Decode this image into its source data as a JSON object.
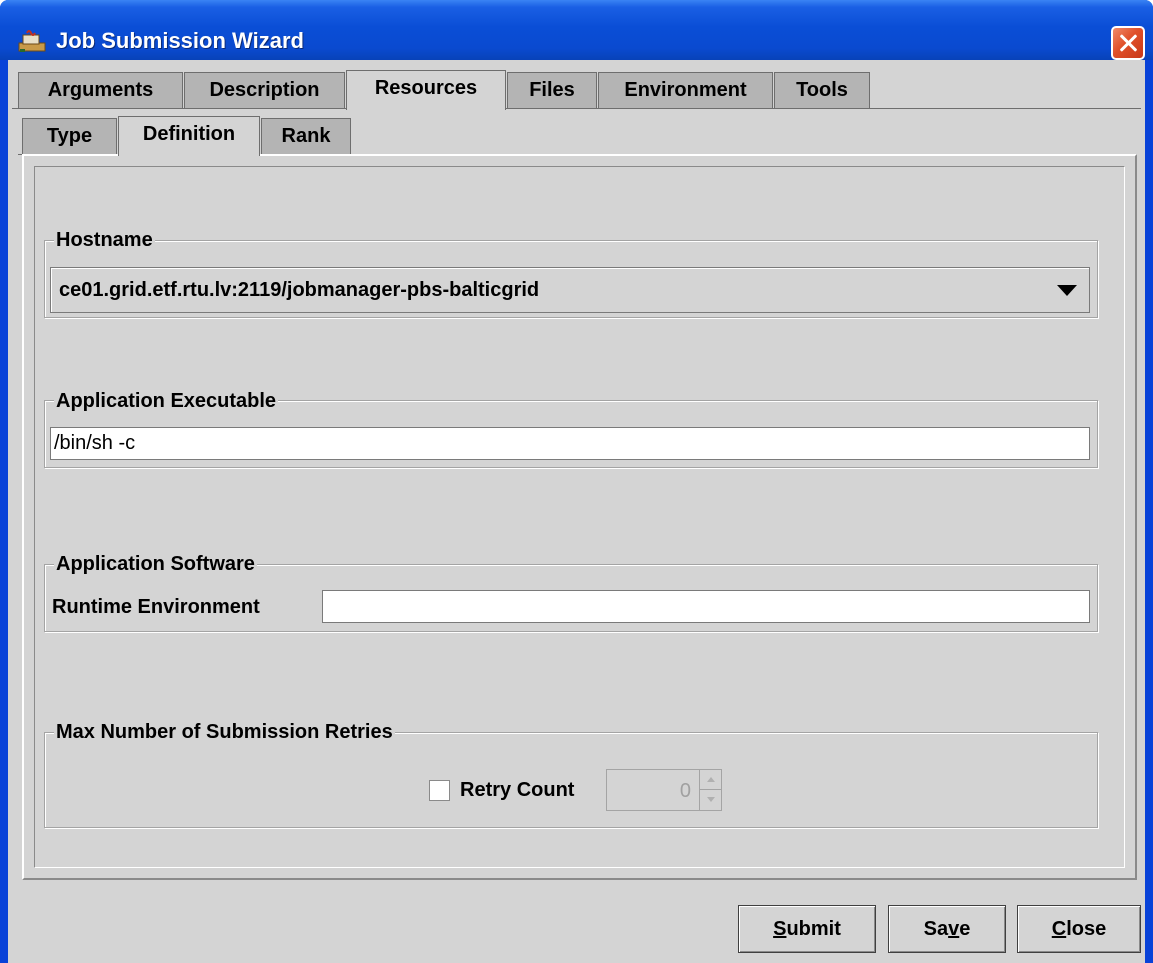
{
  "window": {
    "title": "Job Submission Wizard"
  },
  "main_tabs": [
    {
      "label": "Arguments",
      "selected": false
    },
    {
      "label": "Description",
      "selected": false
    },
    {
      "label": "Resources",
      "selected": true
    },
    {
      "label": "Files",
      "selected": false
    },
    {
      "label": "Environment",
      "selected": false
    },
    {
      "label": "Tools",
      "selected": false
    }
  ],
  "sub_tabs": [
    {
      "label": "Type",
      "selected": false
    },
    {
      "label": "Definition",
      "selected": true
    },
    {
      "label": "Rank",
      "selected": false
    }
  ],
  "hostname": {
    "title": "Hostname",
    "value": "ce01.grid.etf.rtu.lv:2119/jobmanager-pbs-balticgrid"
  },
  "executable": {
    "title": "Application Executable",
    "value": "/bin/sh -c"
  },
  "software": {
    "title": "Application Software",
    "runtime_label": "Runtime Environment",
    "runtime_value": ""
  },
  "retries": {
    "title": "Max Number of Submission Retries",
    "checkbox_label": "Retry Count",
    "checked": false,
    "count": "0"
  },
  "buttons": {
    "submit": {
      "label": "Submit",
      "mnemonic": "S"
    },
    "save": {
      "label": "Save",
      "mnemonic": "v"
    },
    "close": {
      "label": "Close",
      "mnemonic": "C"
    }
  },
  "colors": {
    "titlebar": "#0a4ed6",
    "panel": "#d4d4d4",
    "close_button": "#e0502a"
  }
}
